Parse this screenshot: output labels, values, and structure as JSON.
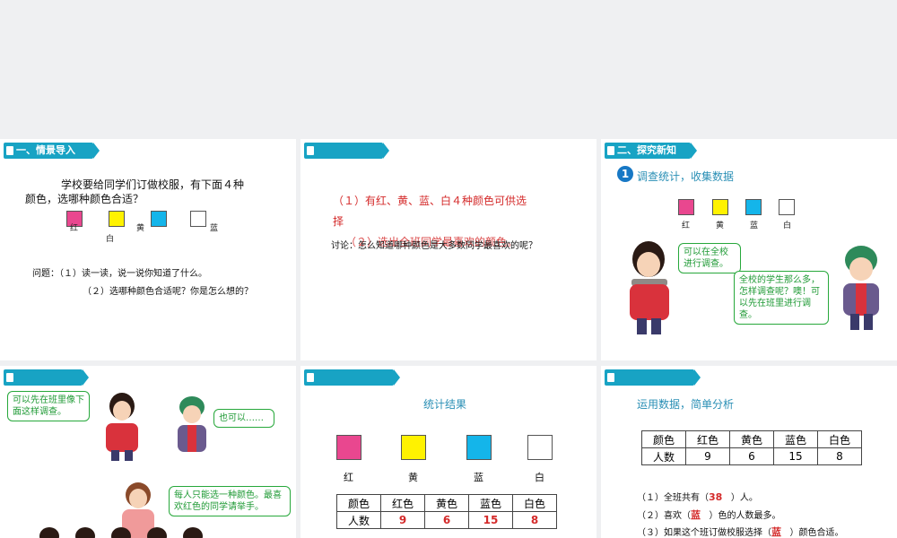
{
  "slide1": {
    "tag": "一、情景导入",
    "intro_line1": "学校要给同学们订做校服，有下面４种",
    "intro_line2": "颜色，选哪种颜色合适？",
    "labels": [
      "红",
      "白",
      "黄",
      "蓝"
    ],
    "q1": "问题：（１）读一读，说一说你知道了什么。",
    "q2": "（２）选哪种颜色合适呢？你是怎么想的？",
    "colors": {
      "red": "#e9478f",
      "yellow": "#fff200",
      "blue": "#14b5ea",
      "white": "#ffffff"
    }
  },
  "slide2": {
    "line1": "（１）有红、黄、蓝、白４种颜色可供选",
    "line2": "择",
    "line3": "（２）选出全班同学最喜欢的颜色。",
    "line4": "讨论：怎么知道哪种颜色是大多数同学最喜欢的呢？"
  },
  "slide3": {
    "tag": "二、探究新知",
    "step_number": "1",
    "heading": "调查统计，收集数据",
    "labels": [
      "红",
      "黄",
      "蓝",
      "白"
    ],
    "bubble_left": "可以在全校进行调查。",
    "bubble_right": "全校的学生那么多，怎样调查呢？噢！可以先在班里进行调查。"
  },
  "slide4": {
    "bubble_a": "可以先在班里像下面这样调查。",
    "bubble_b": "也可以……",
    "bubble_c": "每人只能选一种颜色。最喜欢红色的同学请举手。"
  },
  "slide5": {
    "heading": "统计结果",
    "labels": [
      "红",
      "黄",
      "蓝",
      "白"
    ],
    "table_row1": [
      "颜色",
      "红色",
      "黄色",
      "蓝色",
      "白色"
    ],
    "table_row2_head": "人数",
    "table_values": [
      "9",
      "6",
      "15",
      "8"
    ]
  },
  "slide6": {
    "heading": "运用数据，简单分析",
    "table_row1": [
      "颜色",
      "红色",
      "黄色",
      "蓝色",
      "白色"
    ],
    "table_row2_head": "人数",
    "table_values": [
      "9",
      "6",
      "15",
      "8"
    ],
    "a1_pre": "（１）全班共有（",
    "a1_ans": "38",
    "a1_post": "）人。",
    "a2_pre": "（２）喜欢（",
    "a2_ans": "蓝",
    "a2_post": "）色的人数最多。",
    "a3_pre": "（３）如果这个班订做校服选择（",
    "a3_ans": "蓝",
    "a3_post": "）颜色合适。"
  }
}
